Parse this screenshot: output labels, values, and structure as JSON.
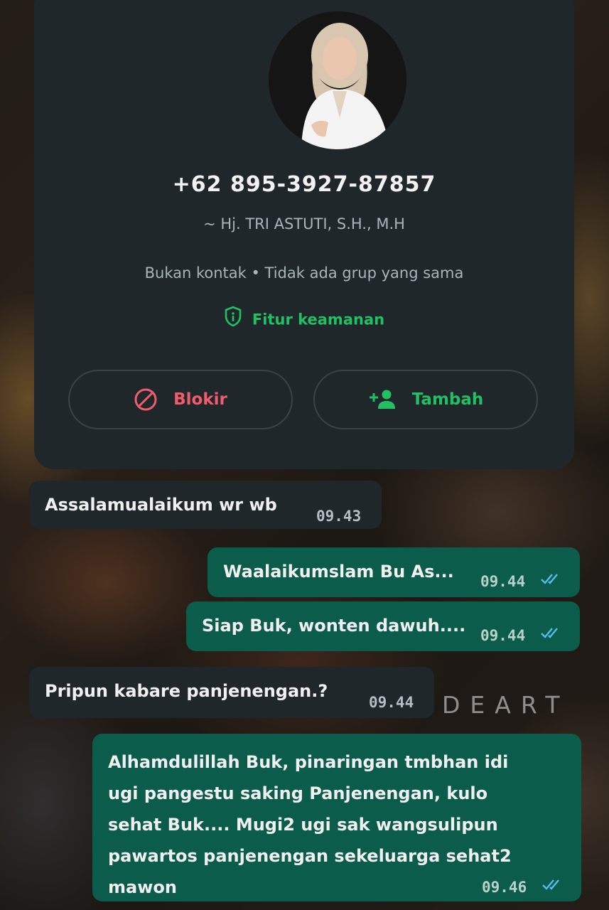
{
  "profile": {
    "phone": "+62 895-3927-87857",
    "push_name": "~ Hj. TRI ASTUTI, S.H., M.H",
    "status": "Bukan kontak • Tidak ada grup yang sama",
    "security_label": "Fitur keamanan",
    "block_label": "Blokir",
    "add_label": "Tambah"
  },
  "watermark": "DEART",
  "messages": [
    {
      "direction": "incoming",
      "text": "Assalamualaikum wr wb",
      "time": "09.43"
    },
    {
      "direction": "outgoing",
      "text": "Waalaikumslam Bu As...",
      "time": "09.44",
      "read": true
    },
    {
      "direction": "outgoing",
      "text": "Siap Buk, wonten dawuh....",
      "time": "09.44",
      "read": true
    },
    {
      "direction": "incoming",
      "text": "Pripun kabare panjenengan.?",
      "time": "09.44"
    },
    {
      "direction": "outgoing",
      "lines": [
        "Alhamdulillah Buk, pinaringan tmbhan idi",
        "ugi pangestu saking Panjenengan, kulo",
        "sehat Buk.... Mugi2 ugi sak wangsulipun",
        "pawartos panjenengan sekeluarga sehat2",
        "mawon"
      ],
      "time": "09.46",
      "read": true
    }
  ],
  "colors": {
    "green_accent": "#21c063",
    "red_accent": "#f15c6d",
    "card_bg": "#1f272b",
    "outgoing_bg": "#0b5c4b",
    "read_tick": "#53bdeb"
  }
}
